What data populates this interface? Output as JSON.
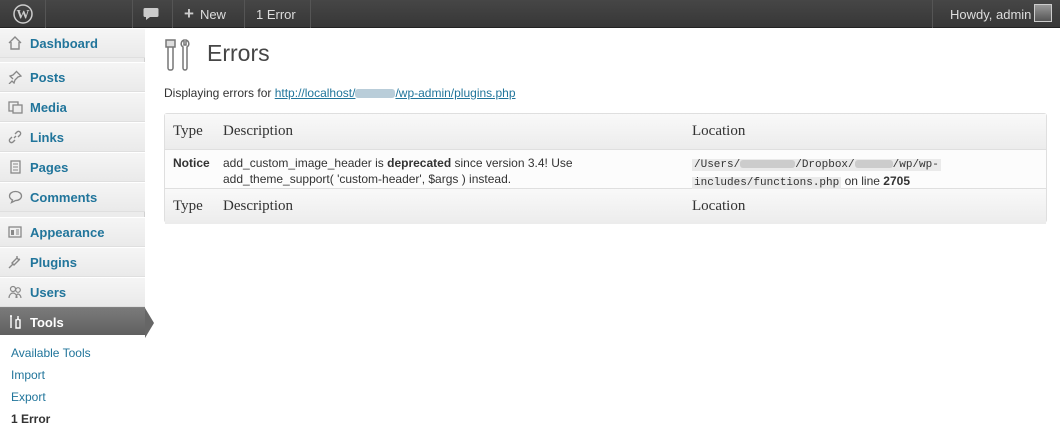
{
  "adminbar": {
    "new_label": "New",
    "error_label": "1 Error",
    "howdy": "Howdy, admin"
  },
  "sidebar": {
    "items": [
      {
        "label": "Dashboard",
        "icon": "home-icon"
      },
      {
        "label": "Posts",
        "icon": "pin-icon"
      },
      {
        "label": "Media",
        "icon": "media-icon"
      },
      {
        "label": "Links",
        "icon": "link-icon"
      },
      {
        "label": "Pages",
        "icon": "pages-icon"
      },
      {
        "label": "Comments",
        "icon": "comments-icon"
      },
      {
        "label": "Appearance",
        "icon": "appearance-icon"
      },
      {
        "label": "Plugins",
        "icon": "plugins-icon"
      },
      {
        "label": "Users",
        "icon": "users-icon"
      },
      {
        "label": "Tools",
        "icon": "tools-icon"
      }
    ],
    "submenu": [
      "Available Tools",
      "Import",
      "Export",
      "1 Error"
    ]
  },
  "main": {
    "title": "Errors",
    "intro_prefix": "Displaying errors for",
    "url_start": "http://localhost/",
    "url_end": "/wp-admin/plugins.php",
    "columns": [
      "Type",
      "Description",
      "Location"
    ],
    "row": {
      "type": "Notice",
      "desc_1": "add_custom_image_header is",
      "desc_bold": "deprecated",
      "desc_2": "since version 3.4! Use",
      "desc_3": "add_theme_support( 'custom-header', $args ) instead.",
      "loc_code_1": "/Users/",
      "loc_code_2": "/Dropbox/",
      "loc_code_3": "/wp/wp-",
      "loc_code_4": "includes/functions.php",
      "loc_suffix": "on line",
      "loc_line": "2705"
    }
  },
  "colors": {
    "link": "#21759b",
    "adminbar": "#464646",
    "current_menu": "#6d6d6d"
  }
}
